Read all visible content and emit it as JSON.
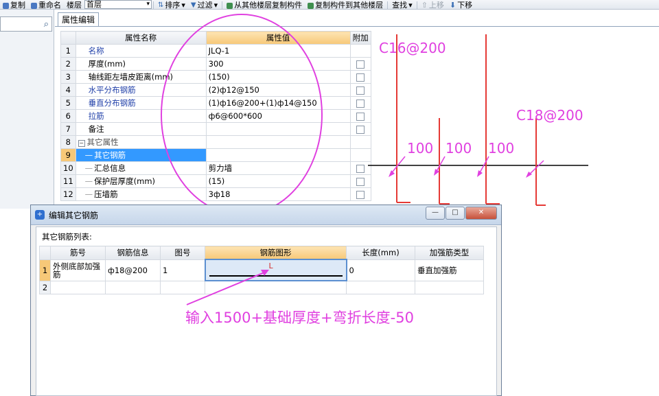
{
  "toolbar": {
    "items": [
      {
        "label": "复制",
        "icon": "copy-icon",
        "color": "#4a78c2"
      },
      {
        "label": "重命名",
        "icon": "rename-icon",
        "color": "#4a78c2"
      },
      {
        "label": "楼层",
        "icon": "",
        "color": ""
      },
      {
        "label": "排序",
        "icon": "sort-icon",
        "color": "#3a6fb5"
      },
      {
        "label": "过滤",
        "icon": "filter-icon",
        "color": "#3a6fb5"
      },
      {
        "label": "从其他楼层复制构件",
        "icon": "copy-from-floor-icon",
        "color": "#3f8f4f"
      },
      {
        "label": "复制构件到其他楼层",
        "icon": "copy-to-floor-icon",
        "color": "#3f8f4f"
      },
      {
        "label": "查找",
        "icon": "",
        "color": ""
      },
      {
        "label": "上移",
        "icon": "up-arrow-icon",
        "color": "#9aa3ad"
      },
      {
        "label": "下移",
        "icon": "down-arrow-icon",
        "color": "#3a6fb5"
      }
    ],
    "floor_value": "首层"
  },
  "left_panel": {
    "search_icon": "search-icon"
  },
  "property_tab": "属性编辑",
  "prop_table": {
    "headers": [
      "属性名称",
      "属性值",
      "附加"
    ],
    "rows": [
      {
        "num": "1",
        "name": "名称",
        "value": "JLQ-1",
        "blue": true,
        "checkbox": false
      },
      {
        "num": "2",
        "name": "厚度(mm)",
        "value": "300",
        "blue": false,
        "checkbox": true
      },
      {
        "num": "3",
        "name": "轴线距左墙皮距离(mm)",
        "value": "(150)",
        "blue": false,
        "checkbox": true
      },
      {
        "num": "4",
        "name": "水平分布钢筋",
        "value": "(2)ф12@150",
        "blue": true,
        "checkbox": true
      },
      {
        "num": "5",
        "name": "垂直分布钢筋",
        "value": "(1)ф16@200+(1)ф14@150",
        "blue": true,
        "checkbox": true
      },
      {
        "num": "6",
        "name": "拉筋",
        "value": "ф6@600*600",
        "blue": true,
        "checkbox": true
      },
      {
        "num": "7",
        "name": "备注",
        "value": "",
        "blue": false,
        "checkbox": true
      },
      {
        "num": "8",
        "name": "其它属性",
        "value": "",
        "blue": false,
        "checkbox": false,
        "group": true
      },
      {
        "num": "9",
        "name": "其它钢筋",
        "value": "",
        "blue": false,
        "checkbox": false,
        "selected": true
      },
      {
        "num": "10",
        "name": "汇总信息",
        "value": "剪力墙",
        "blue": false,
        "checkbox": true
      },
      {
        "num": "11",
        "name": "保护层厚度(mm)",
        "value": "(15)",
        "blue": false,
        "checkbox": true
      },
      {
        "num": "12",
        "name": "压墙筋",
        "value": "3ф18",
        "blue": false,
        "checkbox": true
      }
    ]
  },
  "annotations": {
    "c16": "C16@200",
    "c18": "C18@200",
    "dims": [
      "100",
      "100",
      "100"
    ],
    "instruction": "输入1500+基础厚度+弯折长度-50",
    "color": "#e040e0",
    "line_color": "#e53935"
  },
  "dialog": {
    "title": "编辑其它钢筋",
    "list_label": "其它钢筋列表:",
    "headers": [
      "筋号",
      "钢筋信息",
      "图号",
      "钢筋图形",
      "长度(mm)",
      "加强筋类型"
    ],
    "rows": [
      {
        "num": "1",
        "bar": "外侧底部加强筋",
        "info": "ф18@200",
        "fig": "1",
        "shape_label": "L",
        "length": "0",
        "type": "垂直加强筋"
      },
      {
        "num": "2",
        "bar": "",
        "info": "",
        "fig": "",
        "shape_label": "",
        "length": "",
        "type": ""
      }
    ],
    "buttons": {
      "minimize": "—",
      "maximize": "□",
      "close": "✕"
    }
  }
}
